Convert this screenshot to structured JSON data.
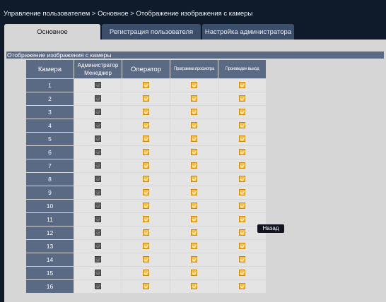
{
  "breadcrumb": "Управление пользователем > Основное > Отображение изображения с камеры",
  "tabs": [
    {
      "label": "Основное",
      "active": true
    },
    {
      "label": "Регистрация пользователя",
      "active": false
    },
    {
      "label": "Настройка администратора",
      "active": false
    }
  ],
  "section_title": "Отображение изображения с камеры",
  "columns": {
    "camera": "Камера",
    "admin_line1": "Администратор",
    "admin_line2": "Менеджер",
    "operator": "Оператор",
    "viewer": "Программа просмотра",
    "output": "Произведен выход"
  },
  "rows": [
    {
      "camera": "1",
      "admin": "disabled",
      "operator": true,
      "viewer": true,
      "output": true
    },
    {
      "camera": "2",
      "admin": "disabled",
      "operator": true,
      "viewer": true,
      "output": true
    },
    {
      "camera": "3",
      "admin": "disabled",
      "operator": true,
      "viewer": true,
      "output": true
    },
    {
      "camera": "4",
      "admin": "disabled",
      "operator": true,
      "viewer": true,
      "output": true
    },
    {
      "camera": "5",
      "admin": "disabled",
      "operator": true,
      "viewer": true,
      "output": true
    },
    {
      "camera": "6",
      "admin": "disabled",
      "operator": true,
      "viewer": true,
      "output": true
    },
    {
      "camera": "7",
      "admin": "disabled",
      "operator": true,
      "viewer": true,
      "output": true
    },
    {
      "camera": "8",
      "admin": "disabled",
      "operator": true,
      "viewer": true,
      "output": true
    },
    {
      "camera": "9",
      "admin": "disabled",
      "operator": true,
      "viewer": true,
      "output": true
    },
    {
      "camera": "10",
      "admin": "disabled",
      "operator": true,
      "viewer": true,
      "output": true
    },
    {
      "camera": "11",
      "admin": "disabled",
      "operator": true,
      "viewer": true,
      "output": true
    },
    {
      "camera": "12",
      "admin": "disabled",
      "operator": true,
      "viewer": true,
      "output": true
    },
    {
      "camera": "13",
      "admin": "disabled",
      "operator": true,
      "viewer": true,
      "output": true
    },
    {
      "camera": "14",
      "admin": "disabled",
      "operator": true,
      "viewer": true,
      "output": true
    },
    {
      "camera": "15",
      "admin": "disabled",
      "operator": true,
      "viewer": true,
      "output": true
    },
    {
      "camera": "16",
      "admin": "disabled",
      "operator": true,
      "viewer": true,
      "output": true
    }
  ],
  "back_button": "Назад",
  "colors": {
    "background": "#0f1b2b",
    "panel": "#d6d6d6",
    "header": "#5a6a84",
    "tab_inactive": "#3b4f6b",
    "checkbox_checked": "#f6c047",
    "checkbox_disabled": "#5b5b5b"
  },
  "icons": {
    "checked": "checkbox-checked-icon",
    "disabled": "checkbox-disabled-icon"
  }
}
